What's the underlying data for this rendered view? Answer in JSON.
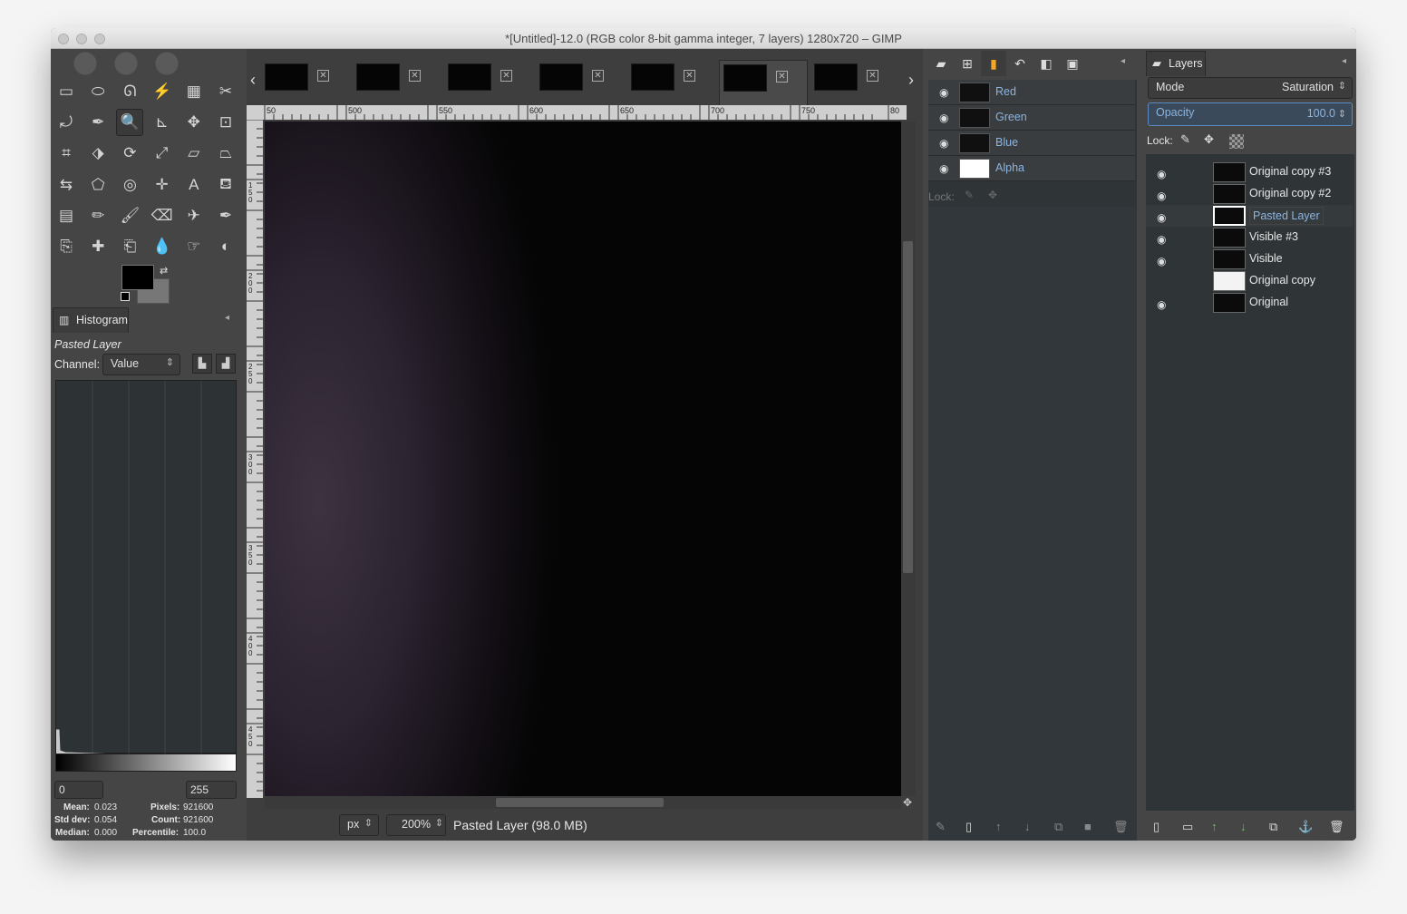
{
  "window": {
    "title": "*[Untitled]-12.0 (RGB color 8-bit gamma integer, 7 layers) 1280x720 – GIMP"
  },
  "toolbox": {
    "tools": [
      "rect-select-icon",
      "ellipse-select-icon",
      "free-select-icon",
      "fuzzy-select-icon",
      "select-by-color-icon",
      "scissors-icon",
      "paths-icon",
      "color-picker-icon",
      "zoom-icon",
      "measure-icon",
      "move-icon",
      "align-icon",
      "crop-icon",
      "unified-transform-icon",
      "rotate-icon",
      "scale-icon",
      "shear-icon",
      "perspective-icon",
      "flip-icon",
      "cage-icon",
      "warp-icon",
      "handle-transform-icon",
      "text-icon",
      "bucket-fill-icon",
      "gradient-icon",
      "pencil-icon",
      "paintbrush-icon",
      "eraser-icon",
      "airbrush-icon",
      "ink-icon",
      "clone-icon",
      "heal-icon",
      "perspective-clone-icon",
      "blur-icon",
      "smudge-icon",
      "dodge-icon"
    ]
  },
  "histogram": {
    "tab": "Histogram",
    "layer_name": "Pasted Layer",
    "channel_label": "Channel:",
    "channel_value": "Value",
    "range_min": "0",
    "range_max": "255",
    "stats": {
      "mean_label": "Mean:",
      "mean": "0.023",
      "std_label": "Std dev:",
      "std": "0.054",
      "median_label": "Median:",
      "median": "0.000",
      "pixels_label": "Pixels:",
      "pixels": "921600",
      "count_label": "Count:",
      "count": "921600",
      "percentile_label": "Percentile:",
      "percentile": "100.0"
    }
  },
  "ruler": {
    "h_labels": [
      "50",
      "500",
      "550",
      "600",
      "650",
      "700",
      "750",
      "80"
    ],
    "v_labels": [
      "150",
      "200",
      "250",
      "300",
      "350",
      "400",
      "450"
    ]
  },
  "status": {
    "unit": "px",
    "zoom": "200%",
    "info": "Pasted Layer (98.0 MB)"
  },
  "channels": {
    "items": [
      {
        "name": "Red"
      },
      {
        "name": "Green"
      },
      {
        "name": "Blue"
      },
      {
        "name": "Alpha"
      }
    ],
    "lock_label": "Lock:"
  },
  "layers": {
    "tab": "Layers",
    "mode_label": "Mode",
    "mode_value": "Saturation",
    "opacity_label": "Opacity",
    "opacity_value": "100.0",
    "lock_label": "Lock:",
    "items": [
      {
        "name": "Original copy #3",
        "visible": true
      },
      {
        "name": "Original copy #2",
        "visible": true
      },
      {
        "name": "Pasted Layer",
        "visible": true,
        "active": true
      },
      {
        "name": "Visible #3",
        "visible": true
      },
      {
        "name": "Visible",
        "visible": true
      },
      {
        "name": "Original copy",
        "visible": false
      },
      {
        "name": "Original",
        "visible": true
      }
    ]
  }
}
